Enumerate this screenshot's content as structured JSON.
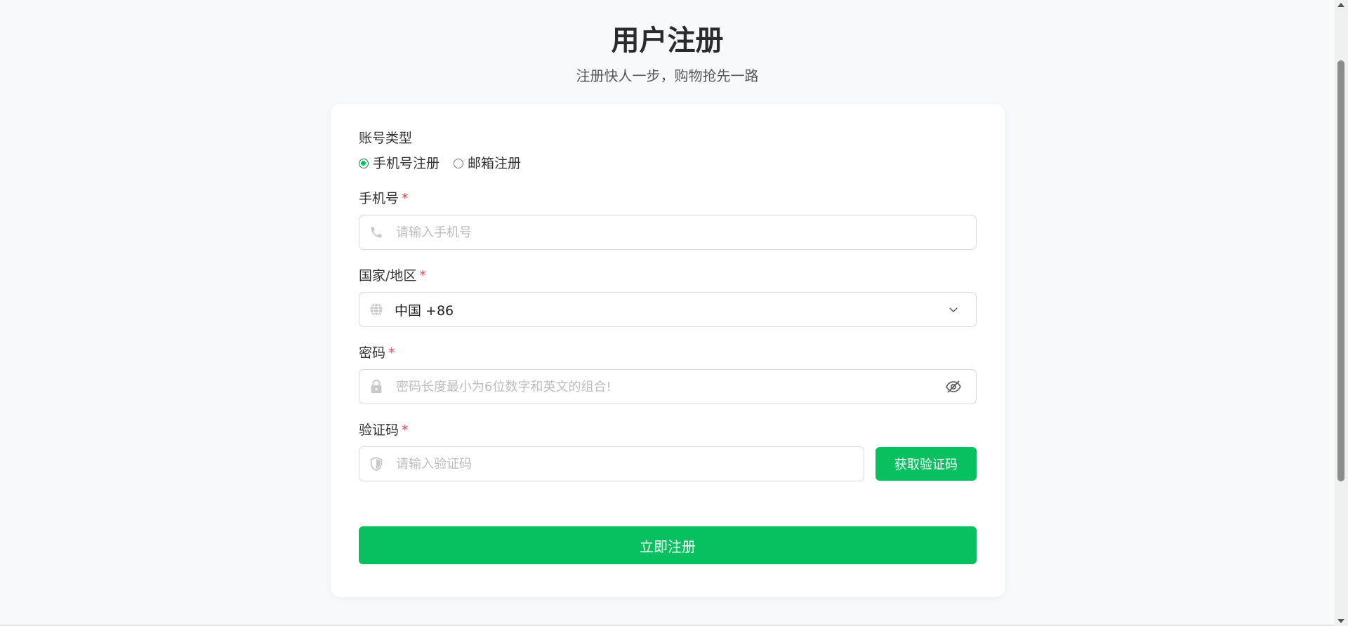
{
  "header": {
    "title": "用户注册",
    "subtitle": "注册快人一步，购物抢先一路"
  },
  "form": {
    "account_type": {
      "label": "账号类型",
      "options": [
        {
          "label": "手机号注册",
          "checked": true
        },
        {
          "label": "邮箱注册",
          "checked": false
        }
      ]
    },
    "phone": {
      "label": "手机号",
      "required_mark": "*",
      "placeholder": "请输入手机号",
      "value": "",
      "icon": "phone-icon"
    },
    "region": {
      "label": "国家/地区",
      "required_mark": "*",
      "selected": "中国 +86",
      "icon": "globe-icon"
    },
    "password": {
      "label": "密码",
      "required_mark": "*",
      "placeholder": "密码长度最小为6位数字和英文的组合!",
      "value": "",
      "icon": "lock-icon",
      "toggle_icon": "eye-off-icon"
    },
    "code": {
      "label": "验证码",
      "required_mark": "*",
      "placeholder": "请输入验证码",
      "value": "",
      "icon": "shield-icon",
      "button_label": "获取验证码"
    },
    "submit_label": "立即注册"
  },
  "colors": {
    "accent": "#07c160",
    "required": "#e5484d",
    "background": "#f7f9fb",
    "card": "#ffffff"
  }
}
